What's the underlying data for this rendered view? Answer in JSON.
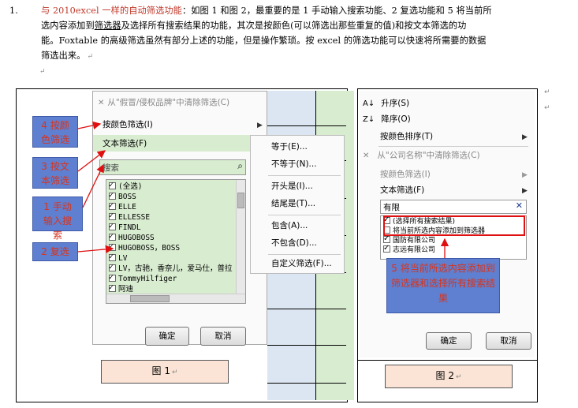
{
  "paragraph": {
    "number": "1.",
    "line1_red": "与 2010excel 一样的自动筛选功能",
    "line1_rest": "：如图 1 和图 2，最重要的是 1 手动输入搜索功能、2 复选功能和 5 将当前所",
    "line2_a": "选内容添加到",
    "line2_ul": "筛选器",
    "line2_b": "及选择所有搜索结果的功能，其次是按颜色(可以筛选出那些重复的值)和按文本筛选的功",
    "line3": "能。Foxtable 的高级筛选虽然有部分上述的功能，但是操作繁琐。按 excel 的筛选功能可以快速将所需要的数据",
    "line4": "筛选出来。",
    "para_mark": "↵"
  },
  "figure1": {
    "menu_items": [
      "从\"假冒/侵权品牌\"中清除筛选(C)",
      "按颜色筛选(I)",
      "文本筛选(F)"
    ],
    "search_placeholder": "搜索",
    "list_items": [
      "(全选)",
      "BOSS",
      "ELLE",
      "ELLESSE",
      "FINDL",
      "HUGOBOSS",
      "HUGOBOSS，BOSS",
      "LV",
      "LV，古驰，香奈儿，爱马仕，普拉",
      "TommyHilfiger",
      "阿迪"
    ],
    "submenu_items": [
      "等于(E)...",
      "不等于(N)...",
      "开头是(I)...",
      "结尾是(T)...",
      "包含(A)...",
      "不包含(D)...",
      "自定义筛选(F)..."
    ],
    "ok_button": "确定",
    "cancel_button": "取消",
    "callouts": [
      "4 按颜色筛选",
      "3 按文本筛选",
      "1 手动输入搜索",
      "2 复选"
    ],
    "caption": "图 1"
  },
  "figure2": {
    "menu_items": [
      "升序(S)",
      "降序(O)",
      "按颜色排序(T)",
      "从\"公司名称\"中清除筛选(C)",
      "按颜色筛选(I)",
      "文本筛选(F)"
    ],
    "search_value": "有限",
    "list_items": [
      "(选择所有搜索结果)",
      "将当前所选内容添加到筛选器",
      "国防有限公司",
      "志远有限公司"
    ],
    "note": "5 将当前所选内容添加到筛选器和选择所有搜索结果",
    "ok_button": "确定",
    "cancel_button": "取消",
    "caption": "图 2"
  },
  "colors": {
    "callout_bg": "#5f7fd0",
    "callout_text": "#d8341c",
    "caption_bg": "#fbe4d5",
    "highlight_red": "#e01010",
    "column_green": "#d8ecd0",
    "column_blue": "#dce6f2"
  }
}
